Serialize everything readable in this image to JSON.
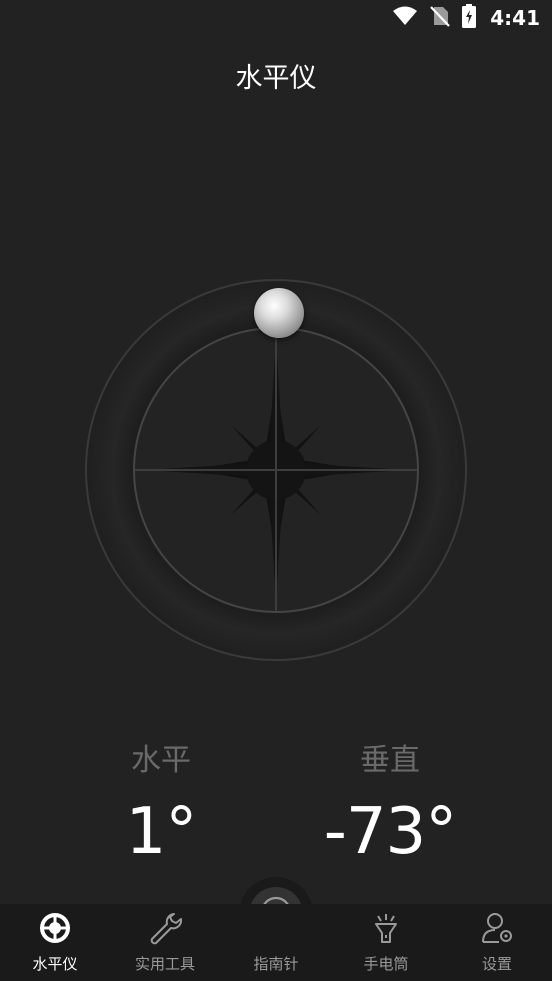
{
  "status": {
    "time": "4:41"
  },
  "header": {
    "title": "水平仪"
  },
  "readings": {
    "horizontal": {
      "label": "水平",
      "value": "1°"
    },
    "vertical": {
      "label": "垂直",
      "value": "-73°"
    }
  },
  "nav": {
    "items": [
      {
        "label": "水平仪",
        "icon": "level-crosshair-icon",
        "active": true
      },
      {
        "label": "实用工具",
        "icon": "wrench-icon"
      },
      {
        "label": "指南针",
        "icon": "compass-icon"
      },
      {
        "label": "手电筒",
        "icon": "flashlight-icon"
      },
      {
        "label": "设置",
        "icon": "user-settings-icon"
      }
    ]
  },
  "colors": {
    "background": "#222222",
    "nav_background": "#1a1a1a",
    "label_gray": "#6a6a6a"
  }
}
